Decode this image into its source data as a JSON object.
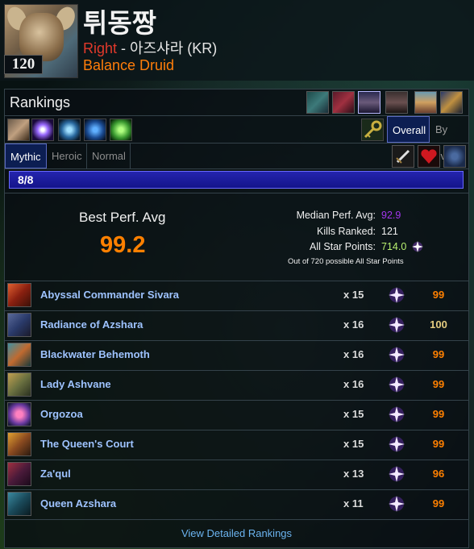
{
  "character": {
    "name": "튀동짱",
    "level": "120",
    "faction": "Right",
    "realm_sep": " - ",
    "realm": "아즈샤라 (KR)",
    "spec": "Balance Druid"
  },
  "rankings": {
    "title": "Rankings",
    "tabs": {
      "overall": "Overall",
      "by_ilvl": "By Ilvl"
    },
    "difficulties": [
      "Mythic",
      "Heroic",
      "Normal"
    ],
    "progress": {
      "label": "8/8",
      "fraction": 1.0
    },
    "summary": {
      "best_label": "Best Perf. Avg",
      "best_value": "99.2",
      "median_label": "Median Perf. Avg:",
      "median_value": "92.9",
      "kills_label": "Kills Ranked:",
      "kills_value": "121",
      "stars_label": "All Star Points:",
      "stars_value": "714.0",
      "stars_note": "Out of 720 possible All Star Points"
    },
    "bosses": [
      {
        "name": "Abyssal Commander Sivara",
        "kills": "x 15",
        "perf": "99",
        "color": "#ff8000"
      },
      {
        "name": "Radiance of Azshara",
        "kills": "x 16",
        "perf": "100",
        "color": "#e5cc80"
      },
      {
        "name": "Blackwater Behemoth",
        "kills": "x 16",
        "perf": "99",
        "color": "#ff8000"
      },
      {
        "name": "Lady Ashvane",
        "kills": "x 16",
        "perf": "99",
        "color": "#ff8000"
      },
      {
        "name": "Orgozoa",
        "kills": "x 15",
        "perf": "99",
        "color": "#ff8000"
      },
      {
        "name": "The Queen's Court",
        "kills": "x 15",
        "perf": "99",
        "color": "#ff8000"
      },
      {
        "name": "Za'qul",
        "kills": "x 13",
        "perf": "96",
        "color": "#ff8000"
      },
      {
        "name": "Queen Azshara",
        "kills": "x 11",
        "perf": "99",
        "color": "#ff8000"
      }
    ],
    "footer_link": "View Detailed Rankings"
  },
  "colors": {
    "legendary": "#ff8000",
    "artifact": "#e5cc80",
    "epic": "#a335ee",
    "uncommon": "#1eff00",
    "link": "#6cb4f0",
    "boss_name": "#9ec3ff",
    "accent_blue": "#0c1e52"
  },
  "icons": {
    "zones": [
      "zone-icon-1",
      "zone-icon-2",
      "zone-icon-3",
      "zone-icon-4",
      "zone-icon-5",
      "zone-icon-6"
    ],
    "raids": [
      "raid-icon-1",
      "raid-icon-2",
      "raid-icon-3",
      "raid-icon-4",
      "raid-icon-5"
    ],
    "metrics": [
      "sword-icon",
      "heart-icon",
      "tank-icon"
    ]
  }
}
